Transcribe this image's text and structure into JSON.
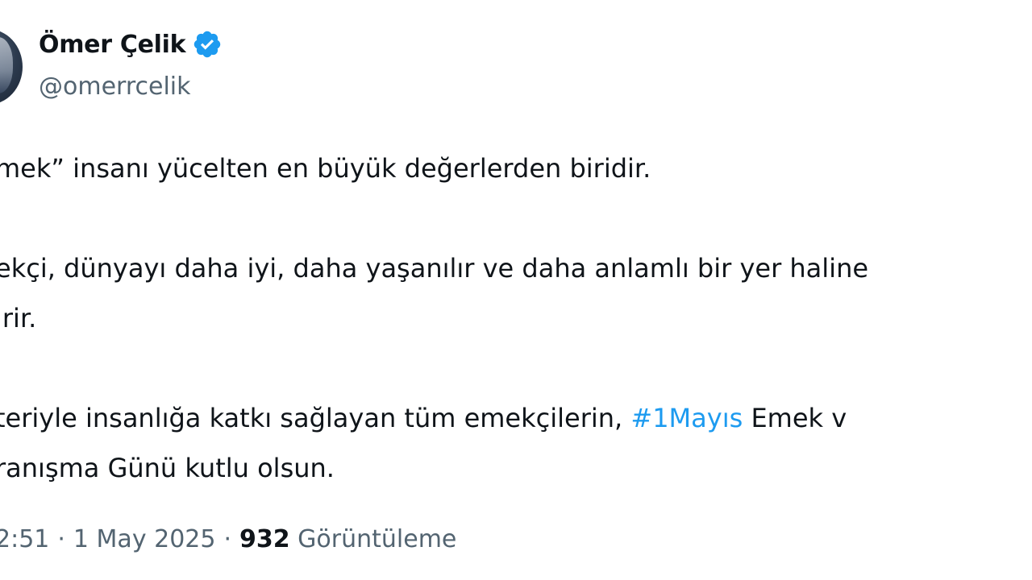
{
  "author": {
    "name": "Ömer Çelik",
    "handle": "@omerrcelik",
    "verified": true
  },
  "tweet": {
    "line1": "mek” insanı yücelten en büyük değerlerden biridir.",
    "line2": "ekçi, dünyayı daha iyi, daha yaşanılır ve daha anlamlı bir yer haline",
    "line3": "irir.",
    "line4_before": " teriyle insanlığa katkı sağlayan tüm emekçilerin, ",
    "hashtag": "#1Mayıs",
    "line4_after": " Emek v",
    "line5": "ranışma Günü kutlu olsun."
  },
  "meta": {
    "time": "2:51",
    "date": "1 May 2025",
    "views_count": "932",
    "views_label": "Görüntüleme",
    "separator": "·"
  },
  "colors": {
    "hashtag": "#1d9bf0",
    "verified": "#1d9bf0",
    "secondary_text": "#536471",
    "primary_text": "#0f1419"
  }
}
